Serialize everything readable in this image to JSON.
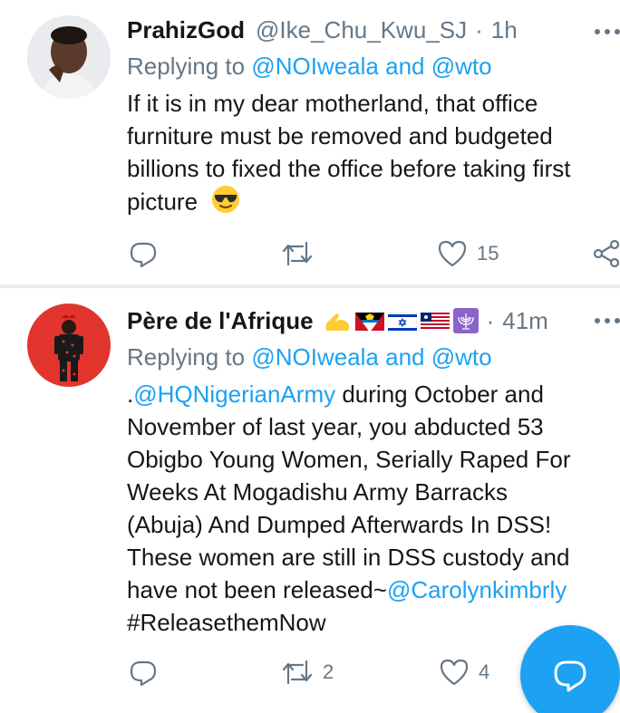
{
  "tweets": [
    {
      "name": "PrahizGod",
      "handle": "@Ike_Chu_Kwu_SJ",
      "dot": "·",
      "time": "1h",
      "replying_prefix": "Replying to",
      "replying_to_1": "@NOIweala",
      "replying_and": "and",
      "replying_to_2": "@wto",
      "lines": [
        "If it is in my dear motherland, that office",
        "furniture must be removed and budgeted",
        "billions to fixed the office before taking first",
        "picture"
      ],
      "emoji": "smiling-face-with-sunglasses-icon",
      "reply_count": "",
      "retweet_count": "",
      "like_count": "15"
    },
    {
      "name": "Père de l'Afrique",
      "name_emoji": [
        "flexed-biceps-icon",
        "antigua-flag-icon",
        "israel-flag-icon",
        "liberia-flag-icon",
        "menorah-icon"
      ],
      "dot": "·",
      "time": "41m",
      "replying_prefix": "Replying to",
      "replying_to_1": "@NOIweala",
      "replying_and": "and",
      "replying_to_2": "@wto",
      "line1_prefix": ".",
      "line1_mention": "@HQNigerianArmy",
      "line1_rest": " during October and",
      "lines": [
        "November of last year, you abducted 53",
        "Obigbo Young Women, Serially Raped For",
        "Weeks At Mogadishu Army Barracks",
        "(Abuja) And Dumped Afterwards In DSS!",
        "These women are still in DSS custody and"
      ],
      "line7_text": "have not been released~",
      "line7_mention": "@Carolynkimbrly",
      "hashtag": "#ReleasethemNow",
      "reply_count": "",
      "retweet_count": "2",
      "like_count": "4"
    }
  ],
  "colors": {
    "accent": "#1da1f2",
    "secondary_text": "#657786",
    "primary_text": "#14171a",
    "separator": "#e6ecf0"
  },
  "fab_icon": "compose-reply-icon"
}
